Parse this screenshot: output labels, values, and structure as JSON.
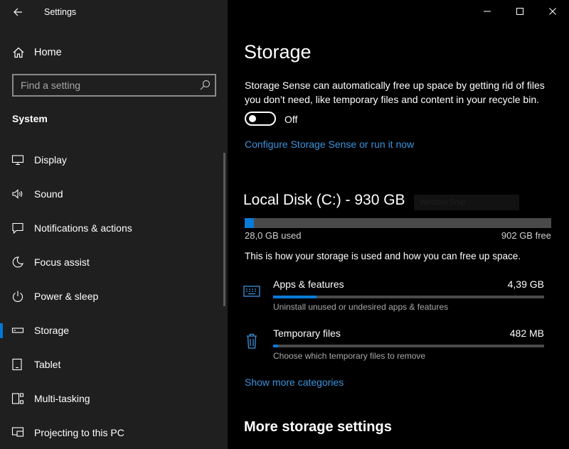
{
  "titlebar": {
    "app_title": "Settings"
  },
  "sidebar": {
    "home_label": "Home",
    "search_placeholder": "Find a setting",
    "section_heading": "System",
    "items": [
      {
        "label": "Display",
        "icon": "display-icon"
      },
      {
        "label": "Sound",
        "icon": "sound-icon"
      },
      {
        "label": "Notifications & actions",
        "icon": "notifications-icon"
      },
      {
        "label": "Focus assist",
        "icon": "focus-assist-icon"
      },
      {
        "label": "Power & sleep",
        "icon": "power-icon"
      },
      {
        "label": "Storage",
        "icon": "storage-icon",
        "selected": true
      },
      {
        "label": "Tablet",
        "icon": "tablet-icon"
      },
      {
        "label": "Multi-tasking",
        "icon": "multitasking-icon"
      },
      {
        "label": "Projecting to this PC",
        "icon": "projecting-icon"
      }
    ]
  },
  "main": {
    "title": "Storage",
    "description": "Storage Sense can automatically free up space by getting rid of files you don’t need, like temporary files and content in your recycle bin.",
    "toggle_state": "Off",
    "configure_link": "Configure Storage Sense or run it now",
    "disk": {
      "title": "Local Disk (C:) - 930 GB",
      "overlay_text": "Window Snip",
      "used": "28,0 GB used",
      "free": "902 GB free",
      "used_fraction": 0.03
    },
    "usage_description": "This is how your storage is used and how you can free up space.",
    "categories": [
      {
        "name": "Apps & features",
        "size": "4,39 GB",
        "subtitle": "Uninstall unused or undesired apps & features",
        "fraction": 0.16,
        "icon": "apps-icon"
      },
      {
        "name": "Temporary files",
        "size": "482 MB",
        "subtitle": "Choose which temporary files to remove",
        "fraction": 0.018,
        "icon": "trash-icon"
      }
    ],
    "show_more": "Show more categories",
    "more_heading": "More storage settings"
  },
  "colors": {
    "accent": "#0078d7",
    "link": "#3b93dd",
    "sidebar_bg": "#1f1f1f",
    "main_bg": "#000000"
  }
}
